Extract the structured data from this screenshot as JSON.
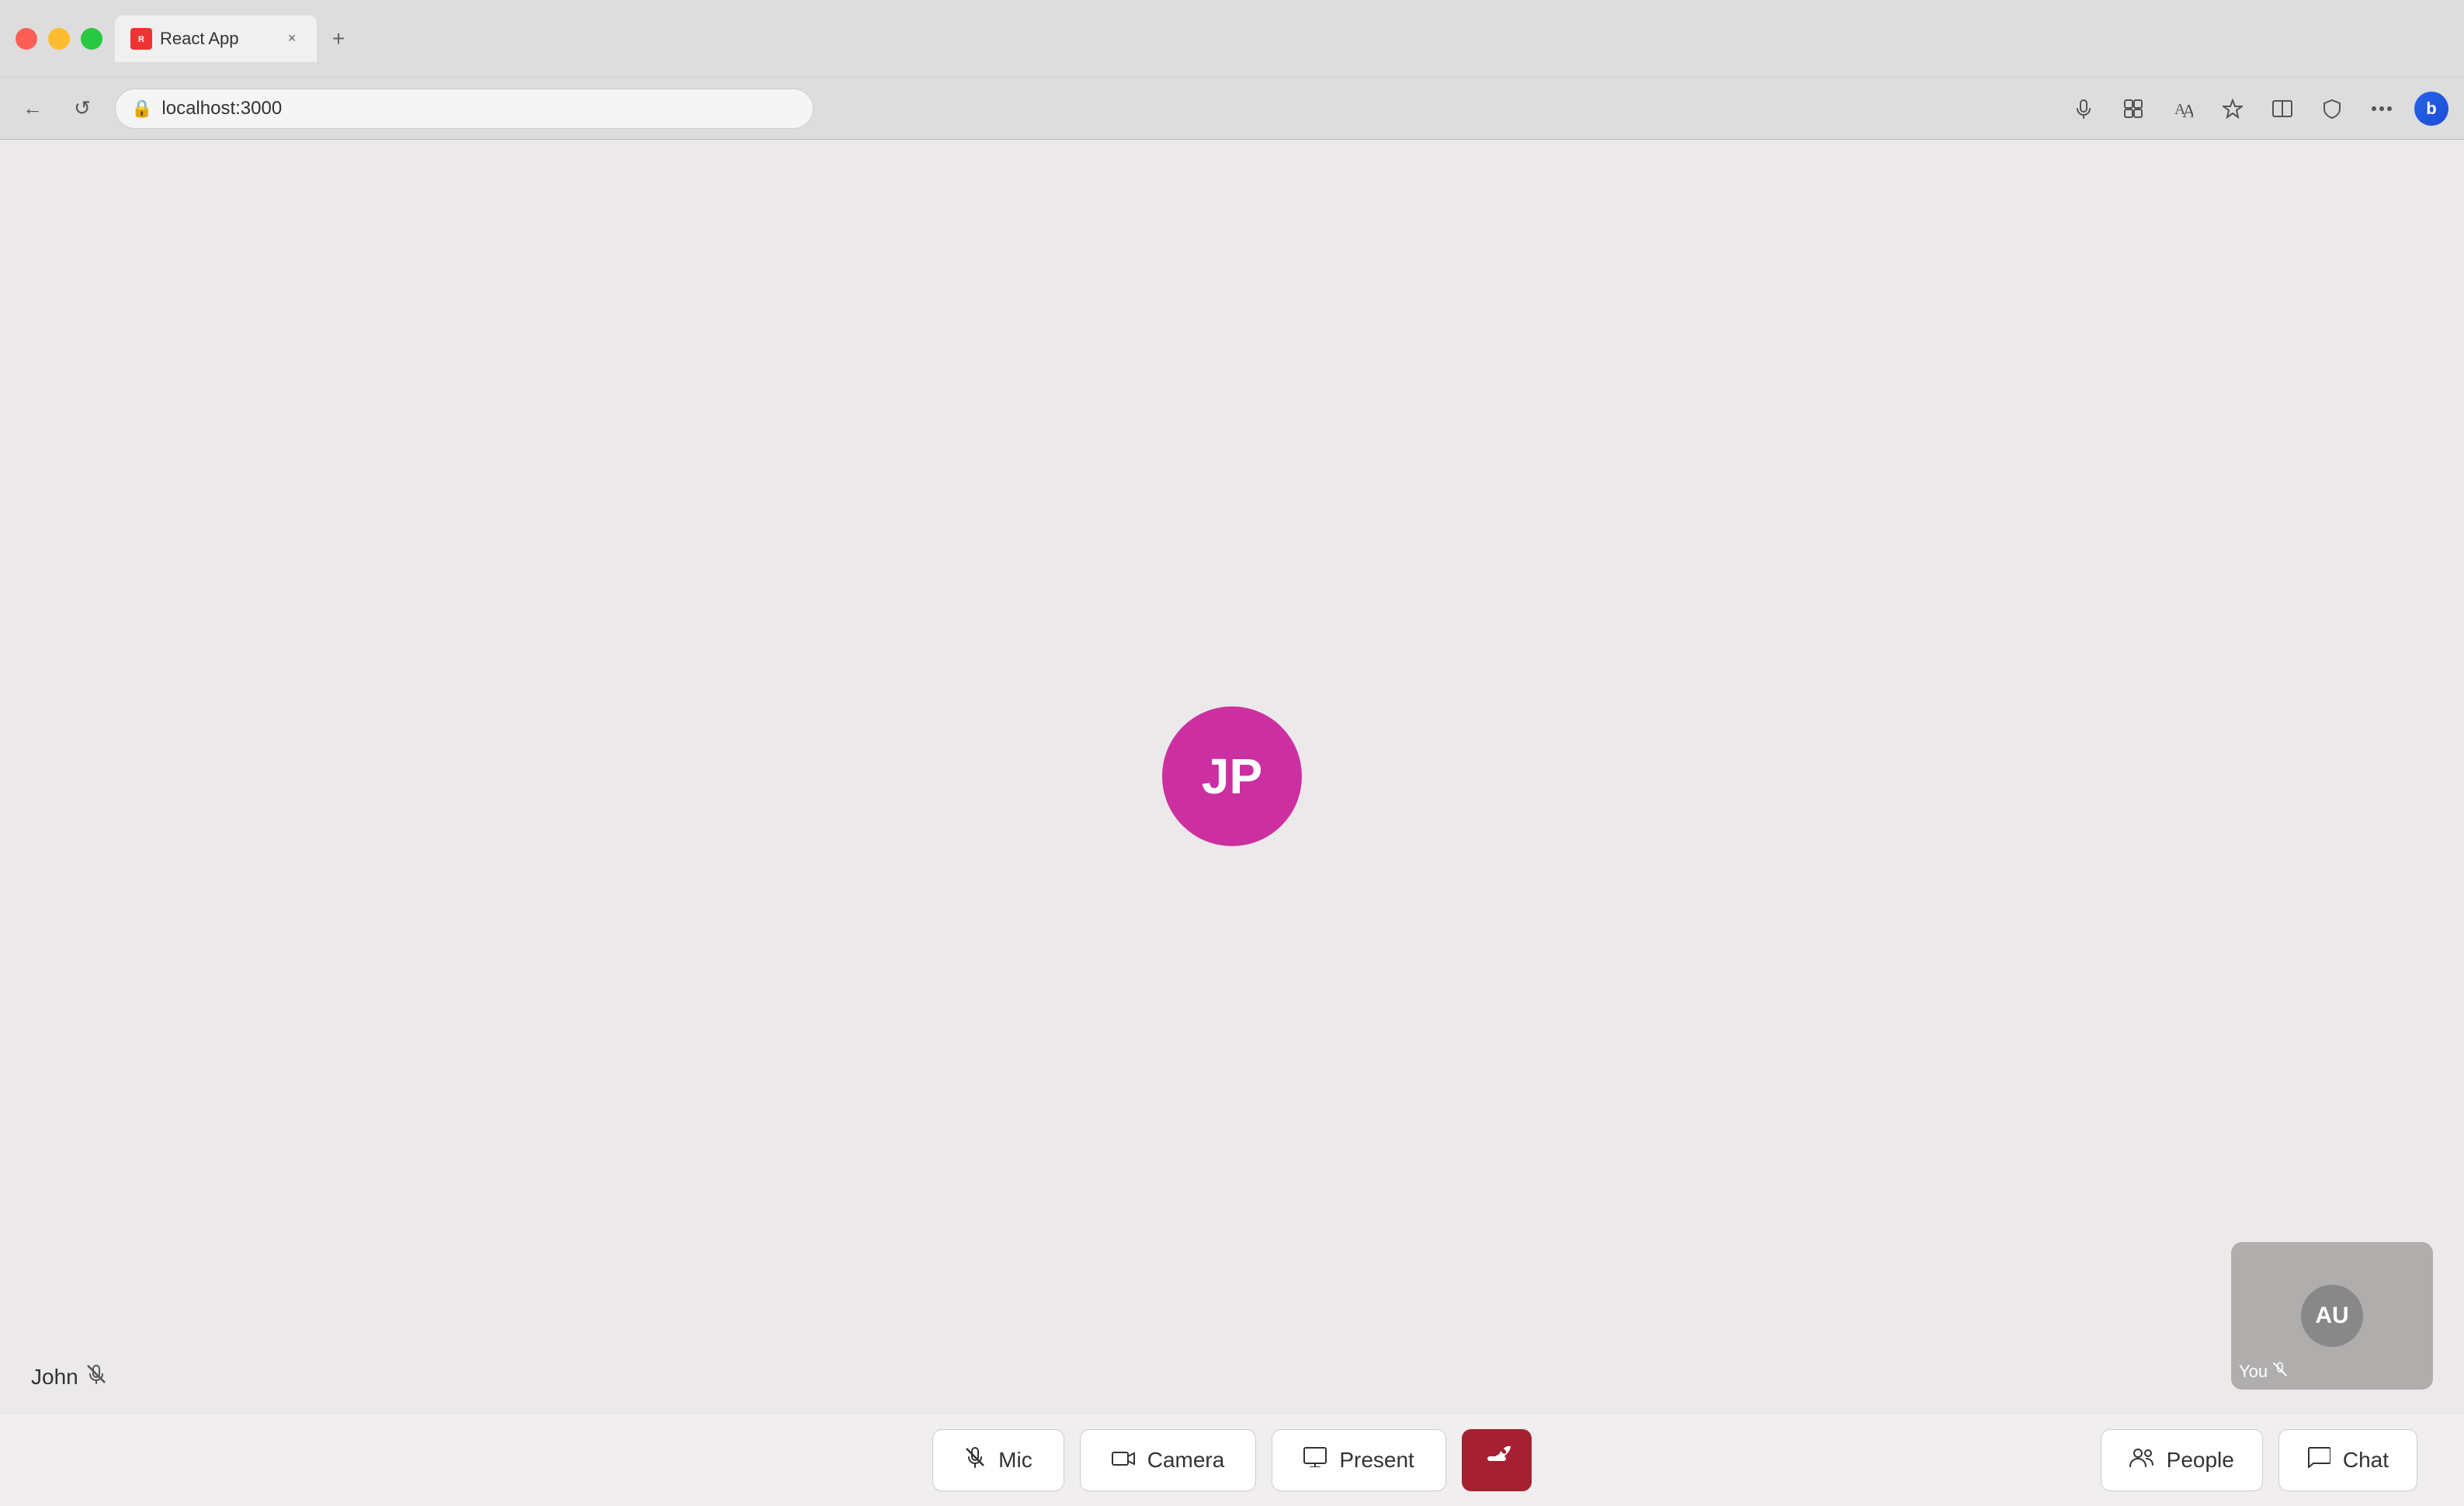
{
  "browser": {
    "tab_title": "React App",
    "tab_favicon": "R",
    "url": "localhost:3000",
    "close_tab": "×",
    "add_tab": "+"
  },
  "nav": {
    "back": "←",
    "refresh": "↺",
    "url_icon": "🔒"
  },
  "video": {
    "main_initials": "JP",
    "main_avatar_color": "#cc2fa0",
    "participant_name": "John",
    "muted_symbol": "🔇",
    "self_initials": "AU",
    "self_label": "You",
    "self_muted": "🔇"
  },
  "toolbar": {
    "mic_label": "Mic",
    "camera_label": "Camera",
    "present_label": "Present",
    "people_label": "People",
    "chat_label": "Chat",
    "mic_icon": "🎤",
    "camera_icon": "📷",
    "present_icon": "🖥",
    "end_call_icon": "📞",
    "people_icon": "👥",
    "chat_icon": "💬"
  },
  "colors": {
    "avatar_magenta": "#cc2fa0",
    "end_call_red": "#a52030",
    "self_avatar_gray": "#888888"
  }
}
